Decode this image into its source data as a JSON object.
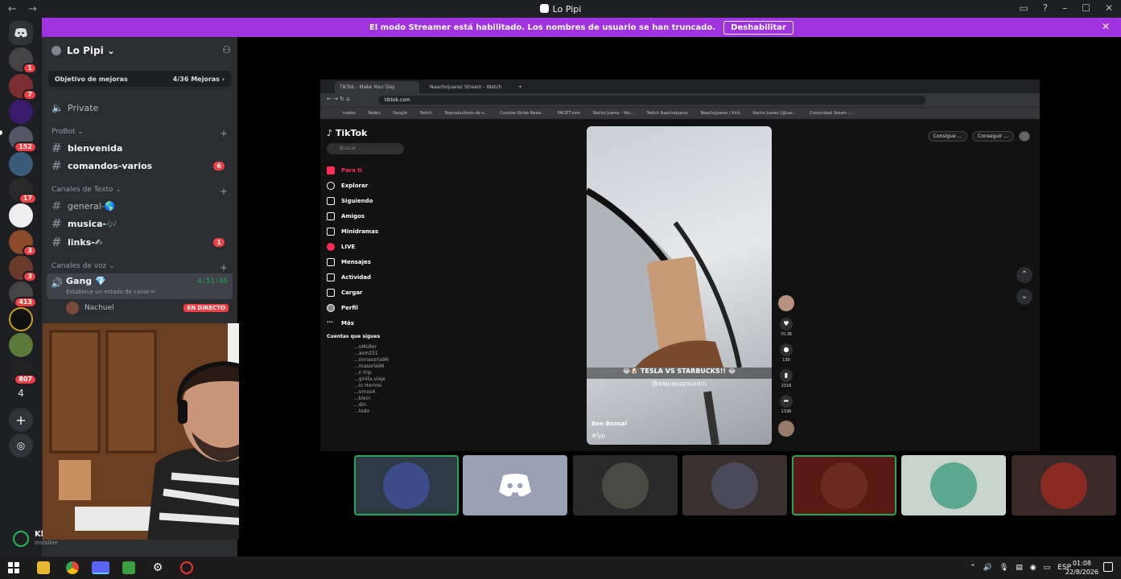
{
  "window": {
    "title": "Lo Pipi",
    "back": "←",
    "forward": "→"
  },
  "banner": {
    "text": "El modo Streamer está habilitado. Los nombres de usuario se han truncado.",
    "button": "Deshabilitar",
    "close": "✕"
  },
  "rail": {
    "badges": [
      "1",
      "7",
      "152",
      "17",
      "3",
      "3",
      "3",
      "413",
      "807"
    ],
    "four_label": "4"
  },
  "sidebar": {
    "server_name": "Lo Pipi",
    "server_chevron": "⌄",
    "boost_label": "Objetivo de mejoras",
    "boost_progress": "4/36 Mejoras ›",
    "private": "Private",
    "probot_cat": "ProBot ⌄",
    "text_cat": "Canales de Texto ⌄",
    "voice_cat": "Canales de voz ⌄",
    "channels": [
      {
        "name": "bienvenida",
        "unread": true,
        "count": ""
      },
      {
        "name": "comandos-varios",
        "unread": true,
        "count": "6"
      },
      {
        "name": "general-🌎",
        "unread": false,
        "count": ""
      },
      {
        "name": "musica-🎶",
        "unread": true,
        "count": ""
      },
      {
        "name": "links-✍",
        "unread": true,
        "count": "1"
      }
    ],
    "voice": {
      "name": "Gang 💎",
      "time": "4:51:06",
      "status": "Establece un estado de canal ✏",
      "user": "Nachuel",
      "live": "EN DIRECTO"
    }
  },
  "userpanel": {
    "name": "Kl",
    "status": "Invisible"
  },
  "stream": {
    "browser": {
      "tabs": [
        "TikTok - Make Your Day",
        "Naachojuarez Stream - Watch"
      ],
      "url": "tiktok.com",
      "bookmarks": [
        "trades",
        "Redes",
        "Google",
        "Twitch",
        "Reproductores de v...",
        "Counter-Strike News...",
        "FACEIT.com",
        "Nacho Juarez - You...",
        "Twitch Naachojuarez",
        "Naachojuarez | Kick",
        "Nacho juarez (@nac...",
        "Comunidad Steam ::..."
      ]
    },
    "tiktok": {
      "logo": "TikTok",
      "search_placeholder": "Buscar",
      "nav": [
        "Para ti",
        "Explorar",
        "Siguiendo",
        "Amigos",
        "Minidramas",
        "LIVE",
        "Mensajes",
        "Actividad",
        "Cargar",
        "Perfil",
        "Más"
      ],
      "following_header": "Cuentas que sigues",
      "following_partial": [
        "...oMüller",
        "...asm231",
        "...onnasoria96",
        "...masoria96",
        "...n trip",
        "...ginita.viaje",
        "...io Hornos",
        "...ornos4",
        "...klein",
        "...din",
        "...todo"
      ],
      "right_buttons": [
        "Consigue ...",
        "Conseguir ..."
      ],
      "caption": "😂🐶 TESLA VS STARBUCKS!! 😂",
      "caption_mirrored": "@awheimtaroqui",
      "author": "Ben Bonsai",
      "hashtag": "#fyp",
      "likes": "70.3K",
      "comments": "130",
      "saves": "2316",
      "shares": "1336"
    }
  },
  "taskbar": {
    "lang": "ESP",
    "time": "01:08",
    "date": "22/8/2026"
  },
  "colors": {
    "discord_bg": "#2b2d31",
    "rail_bg": "#1e1f22",
    "banner": "#a032e0",
    "online_green": "#23a55a",
    "badge_red": "#f23f43",
    "tiktok_red": "#fe2c55"
  }
}
